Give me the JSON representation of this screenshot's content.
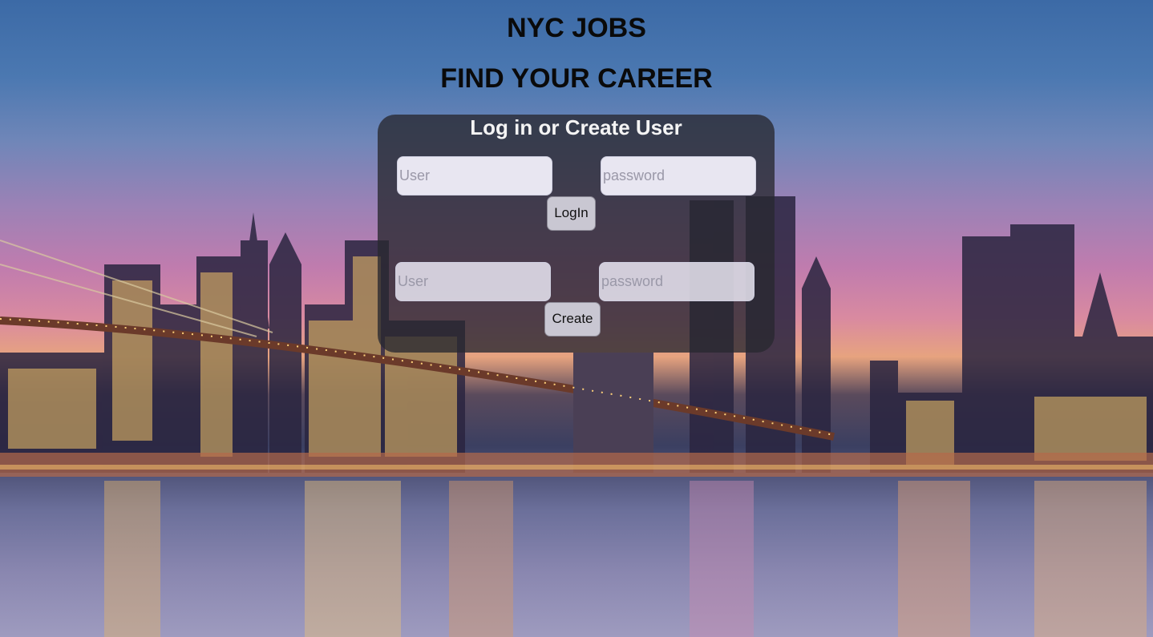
{
  "header": {
    "title": "NYC JOBS",
    "subtitle": "FIND YOUR CAREER"
  },
  "auth_panel": {
    "title": "Log in or Create User",
    "login": {
      "user_placeholder": "User",
      "password_placeholder": "password",
      "button_label": "LogIn"
    },
    "create": {
      "user_placeholder": "User",
      "password_placeholder": "password",
      "button_label": "Create"
    }
  },
  "background": {
    "image": "brooklyn-bridge-skyline-photo"
  }
}
